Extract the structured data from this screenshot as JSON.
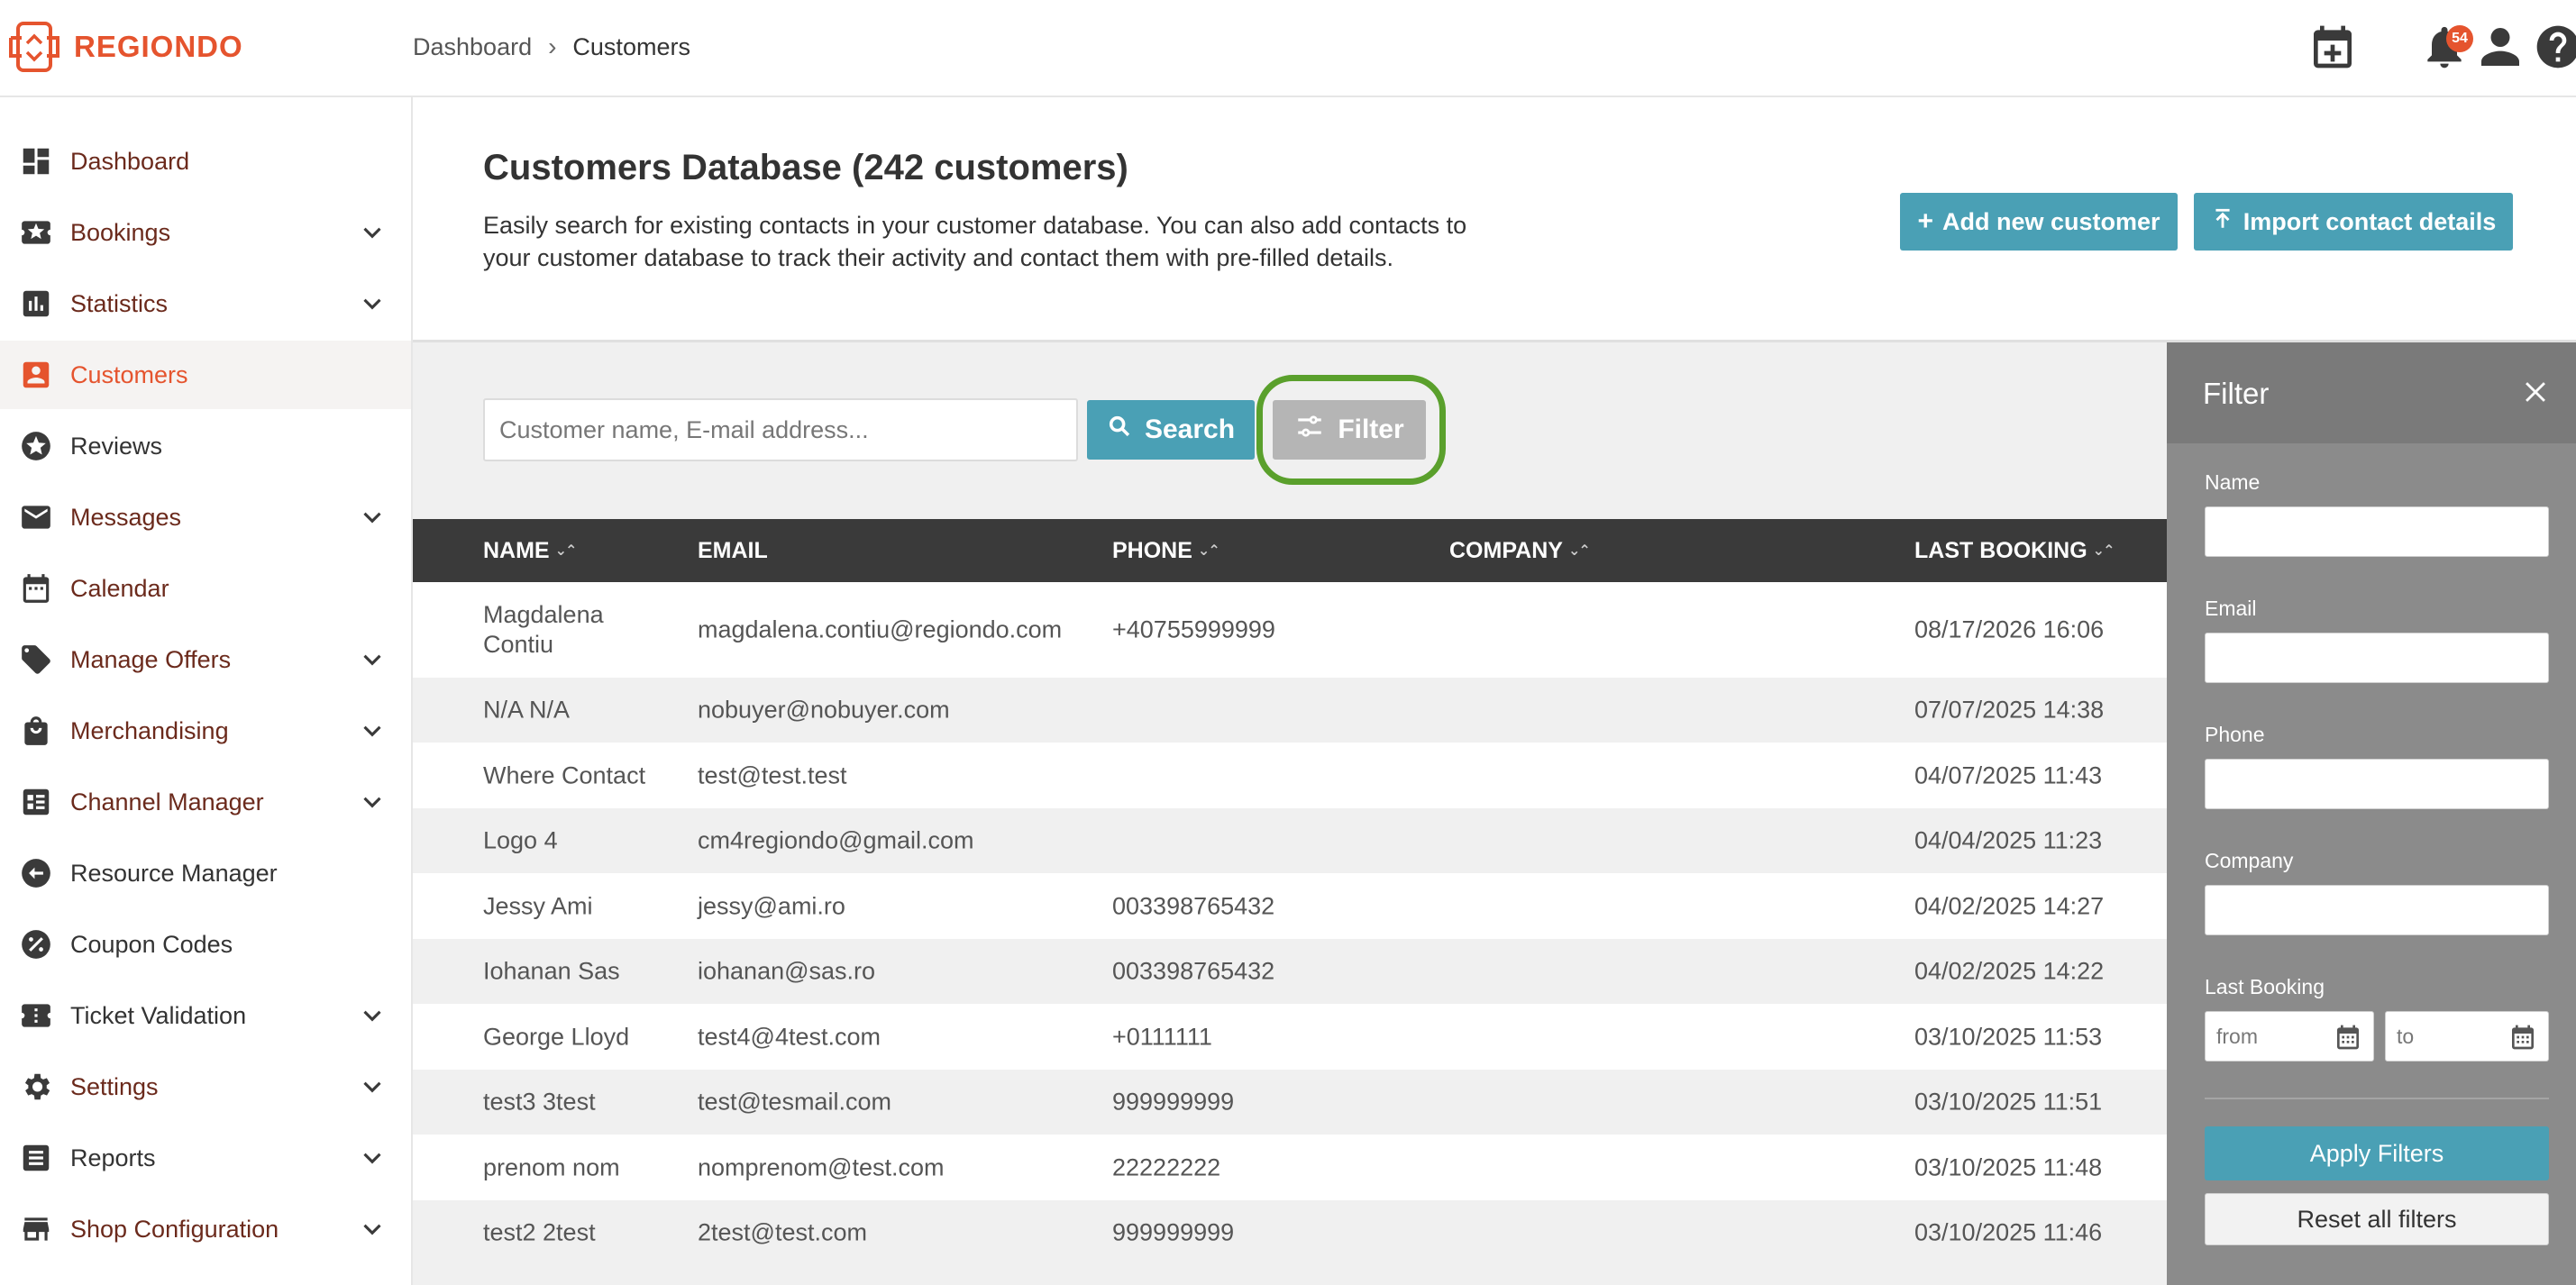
{
  "brand": {
    "name": "REGIONDO",
    "color": "#e5542e"
  },
  "breadcrumb": {
    "items": [
      "Dashboard",
      "Customers"
    ]
  },
  "header": {
    "notification_count": "54",
    "icons": [
      "calendar-add-icon",
      "bell-icon",
      "help-icon",
      "user-icon"
    ]
  },
  "sidebar": {
    "items": [
      {
        "label": "Dashboard",
        "icon": "dashboard-icon",
        "expandable": false
      },
      {
        "label": "Bookings",
        "icon": "ticket-star-icon",
        "expandable": true
      },
      {
        "label": "Statistics",
        "icon": "bar-chart-icon",
        "expandable": true
      },
      {
        "label": "Customers",
        "icon": "contact-card-icon",
        "expandable": false,
        "active": true
      },
      {
        "label": "Reviews",
        "icon": "star-circle-icon",
        "expandable": false
      },
      {
        "label": "Messages",
        "icon": "mail-icon",
        "expandable": true
      },
      {
        "label": "Calendar",
        "icon": "calendar-icon",
        "expandable": false
      },
      {
        "label": "Manage Offers",
        "icon": "tag-icon",
        "expandable": true
      },
      {
        "label": "Merchandising",
        "icon": "shopping-bag-icon",
        "expandable": true
      },
      {
        "label": "Channel Manager",
        "icon": "channel-icon",
        "expandable": true
      },
      {
        "label": "Resource Manager",
        "icon": "resource-icon",
        "expandable": false
      },
      {
        "label": "Coupon Codes",
        "icon": "percent-icon",
        "expandable": false
      },
      {
        "label": "Ticket Validation",
        "icon": "ticket-icon",
        "expandable": true
      },
      {
        "label": "Settings",
        "icon": "gear-icon",
        "expandable": true
      },
      {
        "label": "Reports",
        "icon": "report-icon",
        "expandable": true
      },
      {
        "label": "Shop Configuration",
        "icon": "store-icon",
        "expandable": true
      }
    ]
  },
  "page": {
    "title": "Customers Database (242 customers)",
    "description": "Easily search for existing contacts in your customer database. You can also add contacts to your customer database to track their activity and contact them with pre-filled details.",
    "add_button": "Add new customer",
    "import_button": "Import contact details"
  },
  "search": {
    "placeholder": "Customer name, E-mail address...",
    "search_button": "Search",
    "filter_button": "Filter"
  },
  "table": {
    "columns": [
      "NAME",
      "EMAIL",
      "PHONE",
      "COMPANY",
      "LAST BOOKING"
    ],
    "rows": [
      {
        "name": "Magdalena Contiu",
        "email": "magdalena.contiu@regiondo.com",
        "phone": "+40755999999",
        "company": "",
        "last_booking": "08/17/2026 16:06"
      },
      {
        "name": "N/A N/A",
        "email": "nobuyer@nobuyer.com",
        "phone": "",
        "company": "",
        "last_booking": "07/07/2025 14:38"
      },
      {
        "name": "Where Contact",
        "email": "test@test.test",
        "phone": "",
        "company": "",
        "last_booking": "04/07/2025 11:43"
      },
      {
        "name": "Logo 4",
        "email": "cm4regiondo@gmail.com",
        "phone": "",
        "company": "",
        "last_booking": "04/04/2025 11:23"
      },
      {
        "name": "Jessy Ami",
        "email": "jessy@ami.ro",
        "phone": "003398765432",
        "company": "",
        "last_booking": "04/02/2025 14:27"
      },
      {
        "name": "Iohanan Sas",
        "email": "iohanan@sas.ro",
        "phone": "003398765432",
        "company": "",
        "last_booking": "04/02/2025 14:22"
      },
      {
        "name": "George Lloyd",
        "email": "test4@4test.com",
        "phone": "+0111111",
        "company": "",
        "last_booking": "03/10/2025 11:53"
      },
      {
        "name": "test3 3test",
        "email": "test@tesmail.com",
        "phone": "999999999",
        "company": "",
        "last_booking": "03/10/2025 11:51"
      },
      {
        "name": "prenom nom",
        "email": "nomprenom@test.com",
        "phone": "22222222",
        "company": "",
        "last_booking": "03/10/2025 11:48"
      },
      {
        "name": "test2 2test",
        "email": "2test@test.com",
        "phone": "999999999",
        "company": "",
        "last_booking": "03/10/2025 11:46"
      }
    ]
  },
  "filter_panel": {
    "title": "Filter",
    "fields": [
      "Name",
      "Email",
      "Phone",
      "Company"
    ],
    "last_booking_label": "Last Booking",
    "from_placeholder": "from",
    "to_placeholder": "to",
    "apply_button": "Apply Filters",
    "reset_button": "Reset all filters"
  }
}
